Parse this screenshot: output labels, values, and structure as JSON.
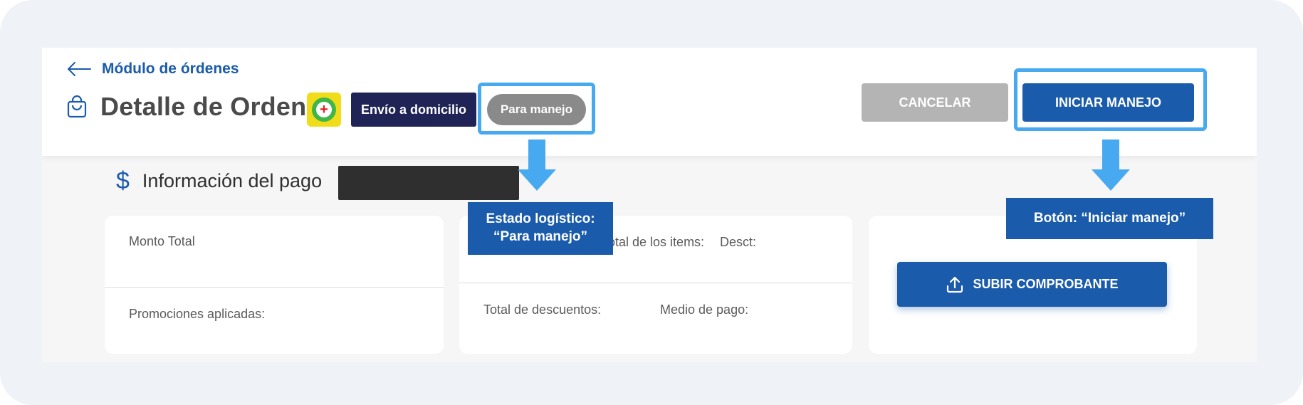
{
  "back_link": {
    "label": "Módulo de órdenes"
  },
  "header": {
    "title": "Detalle de Orden",
    "delivery_chip": "Envío a domicilio",
    "status_chip": "Para manejo",
    "cancel_button": "CANCELAR",
    "start_button": "INICIAR MANEJO"
  },
  "payment_section": {
    "title": "Información del pago",
    "card1": {
      "monto_total": "Monto Total",
      "promociones": "Promociones aplicadas:"
    },
    "card2": {
      "total_items": "Total de los items:",
      "desct": "Desct:",
      "total_descuentos": "Total de descuentos:",
      "medio_pago": "Medio de pago:"
    },
    "card3": {
      "upload_button": "SUBIR COMPROBANTE"
    }
  },
  "annotations": {
    "status_callout_line1": "Estado logístico:",
    "status_callout_line2": "“Para manejo”",
    "button_callout": "Botón: “Iniciar manejo”"
  },
  "colors": {
    "primary_blue": "#1b5bab",
    "highlight": "#47aaf0",
    "dark_chip": "#1f2355",
    "status_gray": "#8a8a8a",
    "cancel_gray": "#b4b4b4"
  }
}
